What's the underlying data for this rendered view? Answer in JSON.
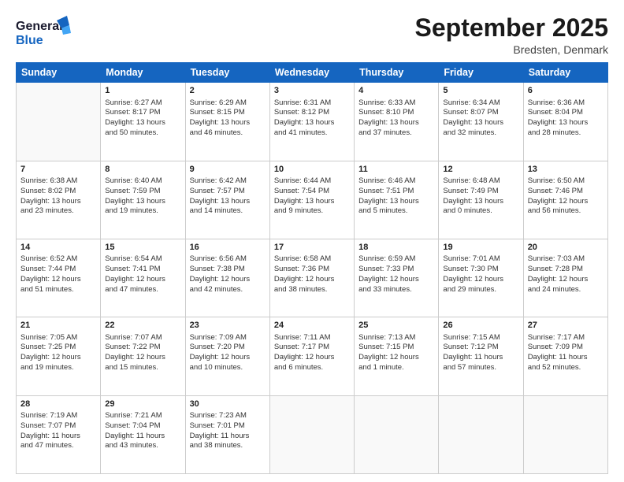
{
  "header": {
    "logo_line1": "General",
    "logo_line2": "Blue",
    "title": "September 2025",
    "subtitle": "Bredsten, Denmark"
  },
  "days_of_week": [
    "Sunday",
    "Monday",
    "Tuesday",
    "Wednesday",
    "Thursday",
    "Friday",
    "Saturday"
  ],
  "weeks": [
    [
      {
        "day": "",
        "info": ""
      },
      {
        "day": "1",
        "info": "Sunrise: 6:27 AM\nSunset: 8:17 PM\nDaylight: 13 hours\nand 50 minutes."
      },
      {
        "day": "2",
        "info": "Sunrise: 6:29 AM\nSunset: 8:15 PM\nDaylight: 13 hours\nand 46 minutes."
      },
      {
        "day": "3",
        "info": "Sunrise: 6:31 AM\nSunset: 8:12 PM\nDaylight: 13 hours\nand 41 minutes."
      },
      {
        "day": "4",
        "info": "Sunrise: 6:33 AM\nSunset: 8:10 PM\nDaylight: 13 hours\nand 37 minutes."
      },
      {
        "day": "5",
        "info": "Sunrise: 6:34 AM\nSunset: 8:07 PM\nDaylight: 13 hours\nand 32 minutes."
      },
      {
        "day": "6",
        "info": "Sunrise: 6:36 AM\nSunset: 8:04 PM\nDaylight: 13 hours\nand 28 minutes."
      }
    ],
    [
      {
        "day": "7",
        "info": "Sunrise: 6:38 AM\nSunset: 8:02 PM\nDaylight: 13 hours\nand 23 minutes."
      },
      {
        "day": "8",
        "info": "Sunrise: 6:40 AM\nSunset: 7:59 PM\nDaylight: 13 hours\nand 19 minutes."
      },
      {
        "day": "9",
        "info": "Sunrise: 6:42 AM\nSunset: 7:57 PM\nDaylight: 13 hours\nand 14 minutes."
      },
      {
        "day": "10",
        "info": "Sunrise: 6:44 AM\nSunset: 7:54 PM\nDaylight: 13 hours\nand 9 minutes."
      },
      {
        "day": "11",
        "info": "Sunrise: 6:46 AM\nSunset: 7:51 PM\nDaylight: 13 hours\nand 5 minutes."
      },
      {
        "day": "12",
        "info": "Sunrise: 6:48 AM\nSunset: 7:49 PM\nDaylight: 13 hours\nand 0 minutes."
      },
      {
        "day": "13",
        "info": "Sunrise: 6:50 AM\nSunset: 7:46 PM\nDaylight: 12 hours\nand 56 minutes."
      }
    ],
    [
      {
        "day": "14",
        "info": "Sunrise: 6:52 AM\nSunset: 7:44 PM\nDaylight: 12 hours\nand 51 minutes."
      },
      {
        "day": "15",
        "info": "Sunrise: 6:54 AM\nSunset: 7:41 PM\nDaylight: 12 hours\nand 47 minutes."
      },
      {
        "day": "16",
        "info": "Sunrise: 6:56 AM\nSunset: 7:38 PM\nDaylight: 12 hours\nand 42 minutes."
      },
      {
        "day": "17",
        "info": "Sunrise: 6:58 AM\nSunset: 7:36 PM\nDaylight: 12 hours\nand 38 minutes."
      },
      {
        "day": "18",
        "info": "Sunrise: 6:59 AM\nSunset: 7:33 PM\nDaylight: 12 hours\nand 33 minutes."
      },
      {
        "day": "19",
        "info": "Sunrise: 7:01 AM\nSunset: 7:30 PM\nDaylight: 12 hours\nand 29 minutes."
      },
      {
        "day": "20",
        "info": "Sunrise: 7:03 AM\nSunset: 7:28 PM\nDaylight: 12 hours\nand 24 minutes."
      }
    ],
    [
      {
        "day": "21",
        "info": "Sunrise: 7:05 AM\nSunset: 7:25 PM\nDaylight: 12 hours\nand 19 minutes."
      },
      {
        "day": "22",
        "info": "Sunrise: 7:07 AM\nSunset: 7:22 PM\nDaylight: 12 hours\nand 15 minutes."
      },
      {
        "day": "23",
        "info": "Sunrise: 7:09 AM\nSunset: 7:20 PM\nDaylight: 12 hours\nand 10 minutes."
      },
      {
        "day": "24",
        "info": "Sunrise: 7:11 AM\nSunset: 7:17 PM\nDaylight: 12 hours\nand 6 minutes."
      },
      {
        "day": "25",
        "info": "Sunrise: 7:13 AM\nSunset: 7:15 PM\nDaylight: 12 hours\nand 1 minute."
      },
      {
        "day": "26",
        "info": "Sunrise: 7:15 AM\nSunset: 7:12 PM\nDaylight: 11 hours\nand 57 minutes."
      },
      {
        "day": "27",
        "info": "Sunrise: 7:17 AM\nSunset: 7:09 PM\nDaylight: 11 hours\nand 52 minutes."
      }
    ],
    [
      {
        "day": "28",
        "info": "Sunrise: 7:19 AM\nSunset: 7:07 PM\nDaylight: 11 hours\nand 47 minutes."
      },
      {
        "day": "29",
        "info": "Sunrise: 7:21 AM\nSunset: 7:04 PM\nDaylight: 11 hours\nand 43 minutes."
      },
      {
        "day": "30",
        "info": "Sunrise: 7:23 AM\nSunset: 7:01 PM\nDaylight: 11 hours\nand 38 minutes."
      },
      {
        "day": "",
        "info": ""
      },
      {
        "day": "",
        "info": ""
      },
      {
        "day": "",
        "info": ""
      },
      {
        "day": "",
        "info": ""
      }
    ]
  ]
}
